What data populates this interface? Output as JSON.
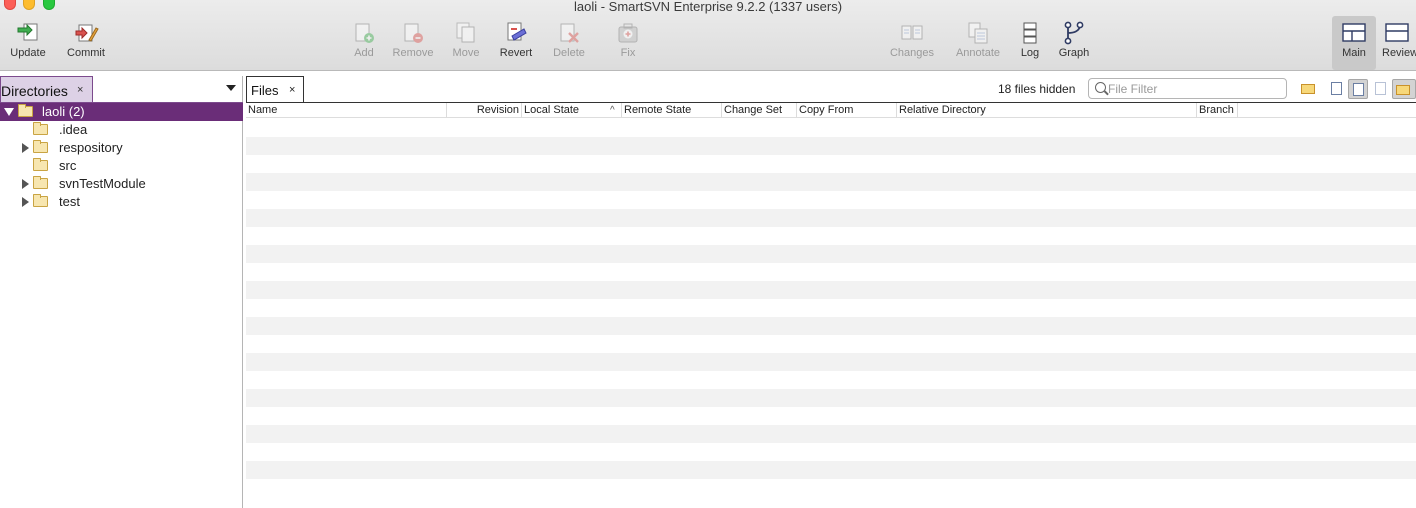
{
  "window": {
    "title": "laoli - SmartSVN Enterprise 9.2.2 (1337 users)"
  },
  "toolbar": {
    "update": "Update",
    "commit": "Commit",
    "add": "Add",
    "remove": "Remove",
    "move": "Move",
    "revert": "Revert",
    "delete": "Delete",
    "fix": "Fix",
    "changes": "Changes",
    "annotate": "Annotate",
    "log": "Log",
    "graph": "Graph",
    "main": "Main",
    "review": "Review"
  },
  "directories": {
    "tab_label": "Directories",
    "close_glyph": "×",
    "tree": [
      {
        "label": "laoli (2)",
        "expanded": true,
        "selected": true
      },
      {
        "label": ".idea",
        "expandable": false
      },
      {
        "label": "respository",
        "expandable": true
      },
      {
        "label": "src",
        "expandable": false
      },
      {
        "label": "svnTestModule",
        "expandable": true
      },
      {
        "label": "test",
        "expandable": true
      }
    ]
  },
  "files": {
    "tab_label": "Files",
    "close_glyph": "×",
    "hidden_count": "18 files hidden",
    "filter_placeholder": "File Filter",
    "columns": [
      "Name",
      "Revision",
      "Local State",
      "Remote State",
      "Change Set",
      "Copy From",
      "Relative Directory",
      "Branch"
    ],
    "sort_indicator": "^",
    "rows": []
  },
  "colors": {
    "selection": "#6a2d78",
    "tab_active_border": "#7c4a8d"
  }
}
